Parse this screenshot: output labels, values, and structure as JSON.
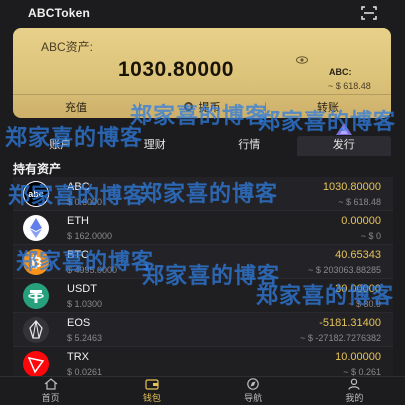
{
  "header": {
    "title": "ABCToken",
    "scan_icon": "scan-icon"
  },
  "card": {
    "label": "ABC资产:",
    "amount": "1030.80000",
    "unit": "ABC:",
    "fiat": "~ $ 618.48",
    "actions": [
      {
        "label": "充值",
        "icon": ""
      },
      {
        "label": "提币",
        "icon": "coin-icon"
      },
      {
        "label": "转账",
        "icon": ""
      }
    ]
  },
  "nav": [
    {
      "label": "账户"
    },
    {
      "label": "理财"
    },
    {
      "label": "行情"
    },
    {
      "label": "发行",
      "icon": "triangle-icon"
    }
  ],
  "section_title": "持有资产",
  "assets": [
    {
      "symbol": "ABC",
      "price": "$ 0.6000",
      "balance": "1030.80000",
      "fiat": "~ $ 618.48",
      "icon_color": "#ffffff"
    },
    {
      "symbol": "ETH",
      "price": "$ 162.0000",
      "balance": "0.00000",
      "fiat": "~ $ 0",
      "icon_color": "#ffffff"
    },
    {
      "symbol": "BTC",
      "price": "$ 4995.0000",
      "balance": "40.65343",
      "fiat": "~ $ 203063.88285",
      "icon_color": "#f7931a"
    },
    {
      "symbol": "USDT",
      "price": "$ 1.0300",
      "balance": "30.00000",
      "fiat": "~ $ 30.9",
      "icon_color": "#26a17b"
    },
    {
      "symbol": "EOS",
      "price": "$ 5.2463",
      "balance": "-5181.31400",
      "fiat": "~ $ -27182.7276382",
      "icon_color": "#333338"
    },
    {
      "symbol": "TRX",
      "price": "$ 0.0261",
      "balance": "10.00000",
      "fiat": "~ $ 0.261",
      "icon_color": "#ff060a"
    }
  ],
  "tabs": [
    {
      "label": "首页",
      "icon": "home-icon"
    },
    {
      "label": "钱包",
      "icon": "wallet-icon",
      "active": true
    },
    {
      "label": "导航",
      "icon": "compass-icon"
    },
    {
      "label": "我的",
      "icon": "user-icon"
    }
  ],
  "watermark": "郑家喜的博客",
  "colors": {
    "gold": "#e6c35a",
    "card_gold": "#dcc37a",
    "bg": "#1c1c1e",
    "watermark": "#2f7de0"
  }
}
